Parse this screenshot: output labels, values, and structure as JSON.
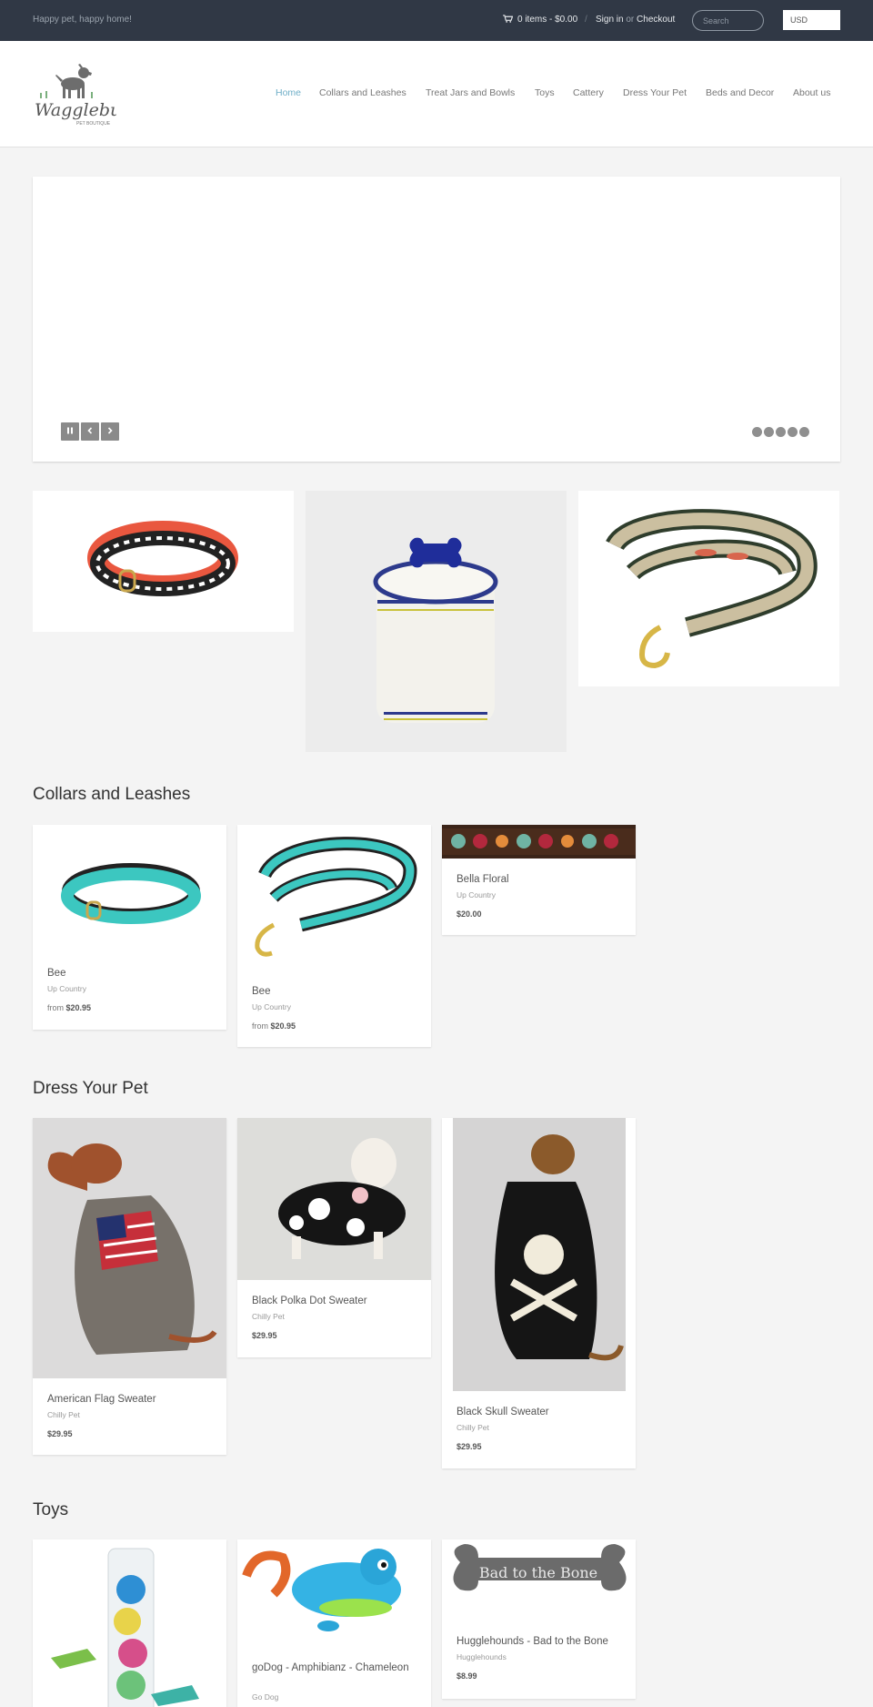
{
  "topbar": {
    "tagline": "Happy pet, happy home!",
    "cart": "0 items - $0.00",
    "separator": "/",
    "sign_in": "Sign in",
    "or": "or",
    "checkout": "Checkout",
    "search_placeholder": "Search",
    "currency": "USD"
  },
  "header": {
    "logo_alt": "Wagglebutz Pet Boutique",
    "logo_text": "Wagglebutz",
    "logo_subtext": "PET BOUTIQUE",
    "nav": [
      {
        "label": "Home"
      },
      {
        "label": "Collars and Leashes"
      },
      {
        "label": "Treat Jars and Bowls"
      },
      {
        "label": "Toys"
      },
      {
        "label": "Cattery"
      },
      {
        "label": "Dress Your Pet"
      },
      {
        "label": "Beds and Decor"
      },
      {
        "label": "About us"
      }
    ]
  },
  "slider": {
    "pause_icon": "pause-icon",
    "prev_icon": "chevron-left-icon",
    "next_icon": "chevron-right-icon",
    "dot_count": 5
  },
  "collars": {
    "title": "Collars and Leashes",
    "products": [
      {
        "name": "Bee",
        "vendor": "Up Country",
        "price_prefix": "from",
        "price": "$20.95"
      },
      {
        "name": "Bee",
        "vendor": "Up Country",
        "price_prefix": "from",
        "price": "$20.95"
      },
      {
        "name": "Bella Floral",
        "vendor": "Up Country",
        "price_prefix": "",
        "price": "$20.00"
      }
    ]
  },
  "dress": {
    "title": "Dress Your Pet",
    "products": [
      {
        "name": "American Flag Sweater",
        "vendor": "Chilly Pet",
        "price": "$29.95"
      },
      {
        "name": "Black Polka Dot Sweater",
        "vendor": "Chilly Pet",
        "price": "$29.95"
      },
      {
        "name": "Black Skull Sweater",
        "vendor": "Chilly Pet",
        "price": "$29.95"
      }
    ]
  },
  "toys": {
    "title": "Toys",
    "products": [
      {
        "name": "",
        "vendor": "",
        "price": ""
      },
      {
        "name": "goDog - Amphibianz - Chameleon",
        "vendor": "Go Dog",
        "price": ""
      },
      {
        "name": "Hugglehounds - Bad to the Bone",
        "vendor": "Hugglehounds",
        "price": "$8.99"
      }
    ],
    "bone_text": "Bad to the Bone"
  },
  "colors": {
    "topbar_bg": "#303845",
    "nav_active": "#6eaec7",
    "page_bg": "#f4f4f4"
  }
}
